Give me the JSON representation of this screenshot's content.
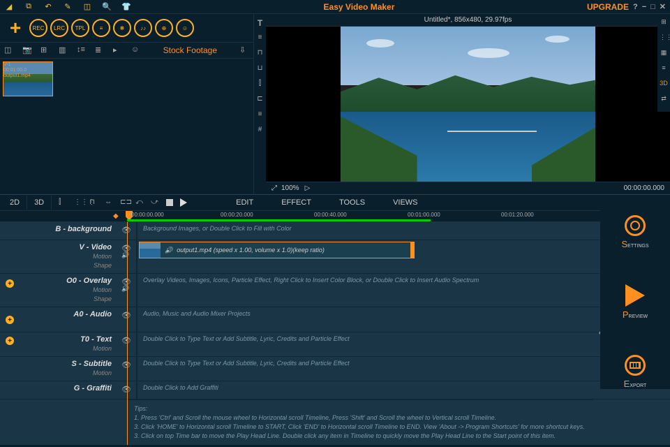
{
  "title": "Easy Video Maker",
  "upgrade": "UPGRADE",
  "preview_info": "Untitled*, 856x480, 29.97fps",
  "zoom": "100%",
  "timecode": "00:00:00.000",
  "circ_buttons": [
    "REC",
    "LRC",
    "TPL",
    "≡",
    "❋",
    "♪♪",
    "⊕",
    "☺"
  ],
  "stock_footage": "Stock Footage",
  "thumb": {
    "id": "V-1",
    "dur": "00:01:00.0",
    "name": "output1.mp4"
  },
  "view_tabs": {
    "v2d": "2D",
    "v3d": "3D"
  },
  "menus": {
    "edit": "EDIT",
    "effect": "EFFECT",
    "tools": "TOOLS",
    "views": "VIEWS"
  },
  "ruler": [
    "00:00:00.000",
    "00:00:20.000",
    "00:00:40.000",
    "00:01:00.000",
    "00:01:20.000"
  ],
  "tracks": {
    "bg": {
      "title": "B - background",
      "hint": "Background Images, or Double Click to Fill with Color"
    },
    "video": {
      "title": "V - Video",
      "sub": "Motion\nShape",
      "clip": "output1.mp4  (speed x 1.00, volume x 1.0)(keep ratio)"
    },
    "overlay": {
      "title": "O0 - Overlay",
      "sub": "Motion\nShape",
      "hint": "Overlay Videos, Images, Icons, Particle Effect, Right Click to Insert Color Block, or Double Click to Insert Audio Spectrum"
    },
    "audio": {
      "title": "A0 - Audio",
      "hint": "Audio, Music and Audio Mixer Projects"
    },
    "text": {
      "title": "T0 - Text",
      "sub": "Motion",
      "hint": "Double Click to Type Text or Add Subtitle, Lyric, Credits and Particle Effect"
    },
    "subtitle": {
      "title": "S - Subtitle",
      "sub": "Motion",
      "hint": "Double Click to Type Text or Add Subtitle, Lyric, Credits and Particle Effect"
    },
    "graffiti": {
      "title": "G - Graffiti",
      "hint": "Double Click to Add Graffiti"
    }
  },
  "tips_title": "Tips:",
  "tips": [
    "1. Press 'Ctrl' and Scroll the mouse wheel to Horizontal scroll Timeline, Press 'Shift' and Scroll the wheel to Vertical scroll Timeline.",
    "3. Click 'HOME' to Horizontal scroll Timeline to START, Click 'END' to Horizontal scroll Timeline to END. View 'About -> Program Shortcuts' for more shortcut keys.",
    "3. Click on top Time bar to move the Play Head Line. Double click any item in Timeline to quickly move the Play Head Line to the Start point of this item."
  ],
  "side": {
    "settings": "Settings",
    "preview": "Preview",
    "export": "Export"
  }
}
